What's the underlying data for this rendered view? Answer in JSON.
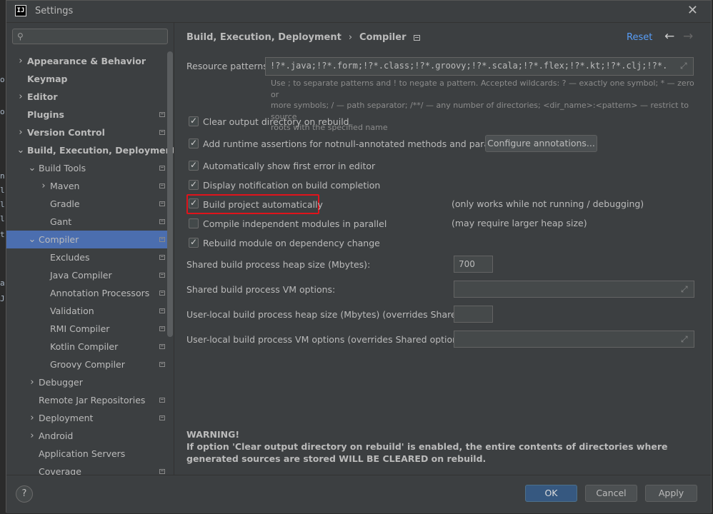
{
  "window": {
    "title": "Settings",
    "app_icon_text": "IJ"
  },
  "search": {
    "placeholder": ""
  },
  "tree": [
    {
      "label": "Appearance & Behavior",
      "indent": 0,
      "chev": "›",
      "bold": true,
      "cfg": false,
      "selected": false
    },
    {
      "label": "Keymap",
      "indent": 0,
      "chev": "",
      "bold": true,
      "cfg": false,
      "selected": false
    },
    {
      "label": "Editor",
      "indent": 0,
      "chev": "›",
      "bold": true,
      "cfg": false,
      "selected": false
    },
    {
      "label": "Plugins",
      "indent": 0,
      "chev": "",
      "bold": true,
      "cfg": true,
      "selected": false
    },
    {
      "label": "Version Control",
      "indent": 0,
      "chev": "›",
      "bold": true,
      "cfg": true,
      "selected": false
    },
    {
      "label": "Build, Execution, Deployment",
      "indent": 0,
      "chev": "⌄",
      "bold": true,
      "cfg": false,
      "selected": false
    },
    {
      "label": "Build Tools",
      "indent": 1,
      "chev": "⌄",
      "bold": false,
      "cfg": true,
      "selected": false
    },
    {
      "label": "Maven",
      "indent": 2,
      "chev": "›",
      "bold": false,
      "cfg": true,
      "selected": false
    },
    {
      "label": "Gradle",
      "indent": 2,
      "chev": "",
      "bold": false,
      "cfg": true,
      "selected": false
    },
    {
      "label": "Gant",
      "indent": 2,
      "chev": "",
      "bold": false,
      "cfg": true,
      "selected": false
    },
    {
      "label": "Compiler",
      "indent": 1,
      "chev": "⌄",
      "bold": false,
      "cfg": true,
      "selected": true
    },
    {
      "label": "Excludes",
      "indent": 2,
      "chev": "",
      "bold": false,
      "cfg": true,
      "selected": false
    },
    {
      "label": "Java Compiler",
      "indent": 2,
      "chev": "",
      "bold": false,
      "cfg": true,
      "selected": false
    },
    {
      "label": "Annotation Processors",
      "indent": 2,
      "chev": "",
      "bold": false,
      "cfg": true,
      "selected": false
    },
    {
      "label": "Validation",
      "indent": 2,
      "chev": "",
      "bold": false,
      "cfg": true,
      "selected": false
    },
    {
      "label": "RMI Compiler",
      "indent": 2,
      "chev": "",
      "bold": false,
      "cfg": true,
      "selected": false
    },
    {
      "label": "Kotlin Compiler",
      "indent": 2,
      "chev": "",
      "bold": false,
      "cfg": true,
      "selected": false
    },
    {
      "label": "Groovy Compiler",
      "indent": 2,
      "chev": "",
      "bold": false,
      "cfg": true,
      "selected": false
    },
    {
      "label": "Debugger",
      "indent": 1,
      "chev": "›",
      "bold": false,
      "cfg": false,
      "selected": false
    },
    {
      "label": "Remote Jar Repositories",
      "indent": 1,
      "chev": "",
      "bold": false,
      "cfg": true,
      "selected": false
    },
    {
      "label": "Deployment",
      "indent": 1,
      "chev": "›",
      "bold": false,
      "cfg": true,
      "selected": false
    },
    {
      "label": "Android",
      "indent": 1,
      "chev": "›",
      "bold": false,
      "cfg": false,
      "selected": false
    },
    {
      "label": "Application Servers",
      "indent": 1,
      "chev": "",
      "bold": false,
      "cfg": false,
      "selected": false
    },
    {
      "label": "Coverage",
      "indent": 1,
      "chev": "",
      "bold": false,
      "cfg": true,
      "selected": false
    }
  ],
  "header": {
    "crumb1": "Build, Execution, Deployment",
    "crumb2": "Compiler",
    "reset": "Reset"
  },
  "resource_patterns": {
    "label": "Resource patterns:",
    "value": "!?*.java;!?*.form;!?*.class;!?*.groovy;!?*.scala;!?*.flex;!?*.kt;!?*.clj;!?*.aj",
    "hint_line1": "Use ; to separate patterns and ! to negate a pattern. Accepted wildcards: ? — exactly one symbol; * — zero or",
    "hint_line2": "more symbols; / — path separator; /**/ — any number of directories; <dir_name>:<pattern> — restrict to source",
    "hint_line3": "roots with the specified name"
  },
  "options": {
    "clear_output": "Clear output directory on rebuild",
    "runtime_assertions": "Add runtime assertions for notnull-annotated methods and parameters",
    "configure_annotations": "Configure annotations...",
    "show_first_error": "Automatically show first error in editor",
    "display_notification": "Display notification on build completion",
    "build_auto": "Build project automatically",
    "build_auto_note": "(only works while not running / debugging)",
    "compile_parallel": "Compile independent modules in parallel",
    "compile_parallel_note": "(may require larger heap size)",
    "rebuild_dependency": "Rebuild module on dependency change"
  },
  "checkbox_states": {
    "clear_output": true,
    "runtime_assertions": true,
    "show_first_error": true,
    "display_notification": true,
    "build_auto": true,
    "compile_parallel": false,
    "rebuild_dependency": true
  },
  "fields": {
    "heap_label": "Shared build process heap size (Mbytes):",
    "heap_value": "700",
    "vm_label": "Shared build process VM options:",
    "vm_value": "",
    "user_heap_label": "User-local build process heap size (Mbytes) (overrides Shared size):",
    "user_heap_value": "",
    "user_vm_label": "User-local build process VM options (overrides Shared options):",
    "user_vm_value": ""
  },
  "warning": {
    "title": "WARNING!",
    "text": "If option 'Clear output directory on rebuild' is enabled, the entire contents of directories where generated sources are stored WILL BE CLEARED on rebuild."
  },
  "footer": {
    "help": "?",
    "ok": "OK",
    "cancel": "Cancel",
    "apply": "Apply"
  },
  "colors": {
    "accent": "#4b6eaf",
    "link": "#589df6",
    "highlight_box": "#e0131b",
    "primary_button": "#365880"
  }
}
